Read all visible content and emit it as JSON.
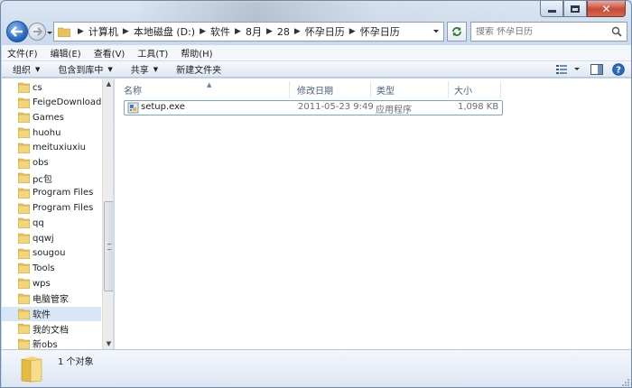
{
  "window": {
    "title": ""
  },
  "address": {
    "crumbs": [
      "计算机",
      "本地磁盘 (D:)",
      "软件",
      "8月",
      "28",
      "怀孕日历",
      "怀孕日历"
    ]
  },
  "search": {
    "placeholder": "搜索 怀孕日历"
  },
  "menubar": {
    "items": [
      "文件(F)",
      "编辑(E)",
      "查看(V)",
      "工具(T)",
      "帮助(H)"
    ]
  },
  "commands": {
    "organize": "组织",
    "include": "包含到库中",
    "share": "共享",
    "new_folder": "新建文件夹"
  },
  "tree": {
    "items": [
      {
        "label": "cs",
        "selected": false
      },
      {
        "label": "FeigeDownload",
        "selected": false
      },
      {
        "label": "Games",
        "selected": false
      },
      {
        "label": "huohu",
        "selected": false
      },
      {
        "label": "meituxiuxiu",
        "selected": false
      },
      {
        "label": "obs",
        "selected": false
      },
      {
        "label": "pc包",
        "selected": false
      },
      {
        "label": "Program Files",
        "selected": false
      },
      {
        "label": "Program Files",
        "selected": false
      },
      {
        "label": "qq",
        "selected": false
      },
      {
        "label": "qqwj",
        "selected": false
      },
      {
        "label": "sougou",
        "selected": false
      },
      {
        "label": "Tools",
        "selected": false
      },
      {
        "label": "wps",
        "selected": false
      },
      {
        "label": "电脑管家",
        "selected": false
      },
      {
        "label": "软件",
        "selected": true
      },
      {
        "label": "我的文档",
        "selected": false
      },
      {
        "label": "新obs",
        "selected": false
      }
    ]
  },
  "columns": {
    "name": "名称",
    "modified": "修改日期",
    "type": "类型",
    "size": "大小"
  },
  "files": [
    {
      "name": "setup.exe",
      "modified": "2011-05-23 9:49",
      "type": "应用程序",
      "size": "1,098 KB"
    }
  ],
  "status": {
    "count": "1 个对象"
  },
  "colors": {
    "accent": "#2a6bc2",
    "selection": "#d9e6f5",
    "folder": "#e8c35c"
  }
}
